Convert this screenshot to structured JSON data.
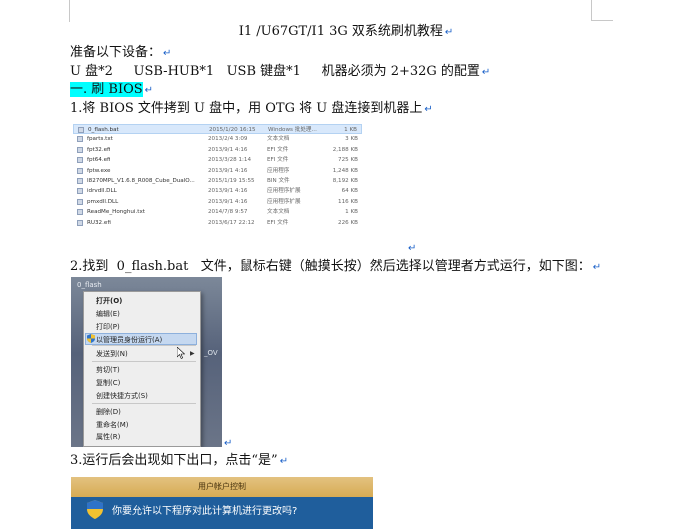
{
  "document": {
    "title": "I1 /U67GT/I1 3G  双系统刷机教程",
    "prep_heading": "准备以下设备：",
    "equipment": "U 盘*2     USB-HUB*1   USB 键盘*1     机器必须为 2+32G 的配置",
    "section1_heading": "一. 刷 BIOS",
    "step1": "1.将 BIOS 文件拷到 U 盘中，用 OTG 将 U 盘连接到机器上",
    "step2": "2.找到  0_flash.bat   文件，鼠标右键（触摸长按）然后选择以管理者方式运行，如下图：",
    "step3": "3.运行后会出现如下出口，点击“是”",
    "paragraph_mark": "↵"
  },
  "file_list": [
    {
      "name": "0_flash.bat",
      "date": "2015/1/20 16:15",
      "type": "Windows 批处理...",
      "size": "1 KB",
      "selected": true
    },
    {
      "name": "fparts.txt",
      "date": "2013/2/4 3:09",
      "type": "文本文档",
      "size": "3 KB"
    },
    {
      "name": "fpt32.efi",
      "date": "2013/9/1 4:16",
      "type": "EFI 文件",
      "size": "2,188 KB"
    },
    {
      "name": "fpt64.efi",
      "date": "2013/3/28 1:14",
      "type": "EFI 文件",
      "size": "725 KB"
    },
    {
      "name": "fptw.exe",
      "date": "2013/9/1 4:16",
      "type": "应用程序",
      "size": "1,248 KB"
    },
    {
      "name": "I8270MPL_V1.6.8_R008_Cube_DualO...",
      "date": "2015/1/19 15:55",
      "type": "BIN 文件",
      "size": "8,192 KB"
    },
    {
      "name": "idrvdll.DLL",
      "date": "2013/9/1 4:16",
      "type": "应用程序扩展",
      "size": "64 KB"
    },
    {
      "name": "pmxdll.DLL",
      "date": "2013/9/1 4:16",
      "type": "应用程序扩展",
      "size": "116 KB"
    },
    {
      "name": "ReadMe_Honghui.txt",
      "date": "2014/7/8 9:57",
      "type": "文本文档",
      "size": "1 KB"
    },
    {
      "name": "RU32.efi",
      "date": "2013/6/17 22:12",
      "type": "EFI 文件",
      "size": "226 KB"
    }
  ],
  "context_menu": {
    "file_label": "0_flash",
    "partial_text": "_OV",
    "items": [
      {
        "label": "打开(O)",
        "bold": true
      },
      {
        "label": "编辑(E)"
      },
      {
        "label": "打印(P)"
      },
      {
        "label": "以管理员身份运行(A)",
        "highlighted": true,
        "icon": "shield-icon"
      },
      {
        "label": "发送到(N)",
        "submenu": true
      },
      {
        "label": "剪切(T)"
      },
      {
        "label": "复制(C)"
      },
      {
        "label": "创建快捷方式(S)"
      },
      {
        "label": "删除(D)"
      },
      {
        "label": "重命名(M)"
      },
      {
        "label": "属性(R)"
      }
    ]
  },
  "uac_dialog": {
    "title": "用户帐户控制",
    "question": "你要允许以下程序对此计算机进行更改吗?"
  },
  "colors": {
    "highlight": "#00ffff",
    "paragraph_mark": "#1a60c8",
    "uac_band": "#1f5e9c"
  }
}
